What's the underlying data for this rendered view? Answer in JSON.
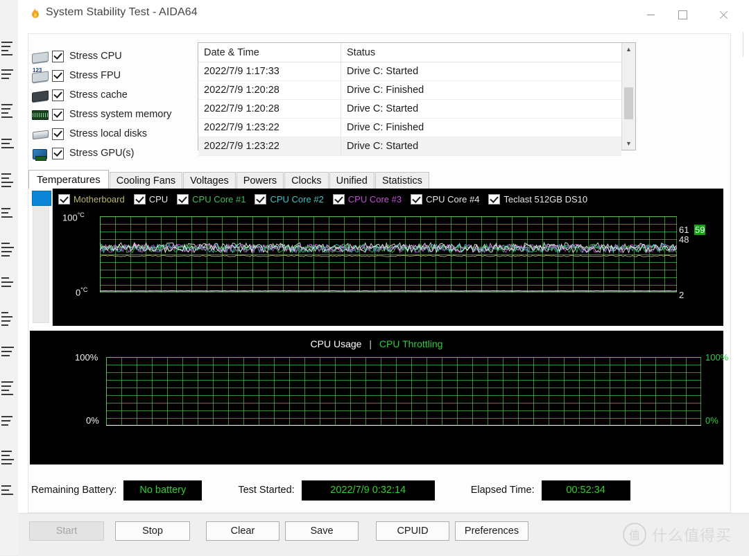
{
  "window": {
    "title": "System Stability Test - AIDA64",
    "app_icon": "flame-icon",
    "minimize_label": "Minimize",
    "maximize_label": "Maximize",
    "close_label": "Close"
  },
  "stress_options": [
    {
      "label": "Stress CPU",
      "checked": true,
      "icon": "cpu-chip-icon"
    },
    {
      "label": "Stress FPU",
      "checked": true,
      "icon": "fpu-chip-icon"
    },
    {
      "label": "Stress cache",
      "checked": true,
      "icon": "cache-chip-icon"
    },
    {
      "label": "Stress system memory",
      "checked": true,
      "icon": "memory-module-icon"
    },
    {
      "label": "Stress local disks",
      "checked": true,
      "icon": "hard-disk-icon"
    },
    {
      "label": "Stress GPU(s)",
      "checked": true,
      "icon": "gpu-card-icon"
    }
  ],
  "log": {
    "columns": [
      "Date & Time",
      "Status"
    ],
    "rows": [
      {
        "datetime": "2022/7/9 1:17:33",
        "status": "Drive C: Started"
      },
      {
        "datetime": "2022/7/9 1:20:28",
        "status": "Drive C: Finished"
      },
      {
        "datetime": "2022/7/9 1:20:28",
        "status": "Drive C: Started"
      },
      {
        "datetime": "2022/7/9 1:23:22",
        "status": "Drive C: Finished"
      },
      {
        "datetime": "2022/7/9 1:23:22",
        "status": "Drive C: Started"
      }
    ],
    "scroll_up": "▲",
    "scroll_down": "▼"
  },
  "tabs": [
    {
      "label": "Temperatures",
      "active": true
    },
    {
      "label": "Cooling Fans",
      "active": false
    },
    {
      "label": "Voltages",
      "active": false
    },
    {
      "label": "Powers",
      "active": false
    },
    {
      "label": "Clocks",
      "active": false
    },
    {
      "label": "Unified",
      "active": false
    },
    {
      "label": "Statistics",
      "active": false
    }
  ],
  "temperature_chart": {
    "legend": [
      {
        "label": "Motherboard",
        "color": "#b9b96a",
        "checked": true
      },
      {
        "label": "CPU",
        "color": "#e8e8e8",
        "checked": true
      },
      {
        "label": "CPU Core #1",
        "color": "#3fbf5a",
        "checked": true
      },
      {
        "label": "CPU Core #2",
        "color": "#3fc3c3",
        "checked": true
      },
      {
        "label": "CPU Core #3",
        "color": "#c14fd6",
        "checked": true
      },
      {
        "label": "CPU Core #4",
        "color": "#e8e8e8",
        "checked": true
      },
      {
        "label": "Teclast 512GB DS10",
        "color": "#e8e8e8",
        "checked": true
      }
    ],
    "y_top_label": "100",
    "y_top_unit": "°C",
    "y_bottom_label": "0",
    "y_bottom_unit": "°C",
    "right_values": [
      {
        "text": "61",
        "color": "#e8e8e8",
        "highlight": false
      },
      {
        "text": "59",
        "color": "#eaffea",
        "highlight": true
      },
      {
        "text": "48",
        "color": "#e8e8e8",
        "highlight": false
      },
      {
        "text": "2",
        "color": "#e8e8e8",
        "highlight": false
      }
    ],
    "grid_color": "#40be40"
  },
  "usage_chart": {
    "title_usage": "CPU Usage",
    "title_separator": "|",
    "title_throttling": "CPU Throttling",
    "y_top_left": "100%",
    "y_bottom_left": "0%",
    "y_top_right": "100%",
    "y_bottom_right": "0%",
    "grid_color": "#40be40",
    "usage_color": "#ffffff",
    "throttling_color": "#2ecc40"
  },
  "chart_data": {
    "type": "line",
    "charts": [
      {
        "title": "Temperatures",
        "ylabel": "°C",
        "ylim": [
          0,
          100
        ],
        "grid": true,
        "legend_position": "top",
        "categories": [],
        "series": [
          {
            "name": "Motherboard",
            "color": "#b9b96a",
            "current": 48,
            "mean": 48,
            "min": 47,
            "max": 49
          },
          {
            "name": "CPU",
            "color": "#e8e8e8",
            "current": 61,
            "mean": 60,
            "min": 55,
            "max": 66
          },
          {
            "name": "CPU Core #1",
            "color": "#3fbf5a",
            "current": 59,
            "mean": 58,
            "min": 53,
            "max": 64
          },
          {
            "name": "CPU Core #2",
            "color": "#3fc3c3",
            "current": 59,
            "mean": 58,
            "min": 53,
            "max": 64
          },
          {
            "name": "CPU Core #3",
            "color": "#c14fd6",
            "current": 59,
            "mean": 58,
            "min": 53,
            "max": 64
          },
          {
            "name": "CPU Core #4",
            "color": "#e8e8e8",
            "current": 59,
            "mean": 58,
            "min": 53,
            "max": 64
          },
          {
            "name": "Teclast 512GB DS10",
            "color": "#e8e8e8",
            "current": 2,
            "mean": 2,
            "min": 2,
            "max": 2
          }
        ]
      },
      {
        "title": "CPU Usage | CPU Throttling",
        "ylabel": "%",
        "ylim": [
          0,
          100
        ],
        "grid": true,
        "legend_position": "top",
        "categories": [],
        "series": [
          {
            "name": "CPU Usage",
            "color": "#ffffff",
            "current": 0,
            "mean": 0,
            "min": 0,
            "max": 0
          },
          {
            "name": "CPU Throttling",
            "color": "#2ecc40",
            "current": 0,
            "mean": 0,
            "min": 0,
            "max": 0
          }
        ]
      }
    ]
  },
  "status": {
    "battery_label": "Remaining Battery:",
    "battery_value": "No battery",
    "started_label": "Test Started:",
    "started_value": "2022/7/9 0:32:14",
    "elapsed_label": "Elapsed Time:",
    "elapsed_value": "00:52:34",
    "value_color": "#2fd02f"
  },
  "buttons": [
    {
      "label": "Start",
      "disabled": true
    },
    {
      "label": "Stop",
      "disabled": false
    },
    {
      "label": "Clear",
      "disabled": false
    },
    {
      "label": "Save",
      "disabled": false
    },
    {
      "label": "CPUID",
      "disabled": false
    },
    {
      "label": "Preferences",
      "disabled": false
    }
  ],
  "watermark": {
    "badge": "值",
    "text": "什么值得买"
  }
}
